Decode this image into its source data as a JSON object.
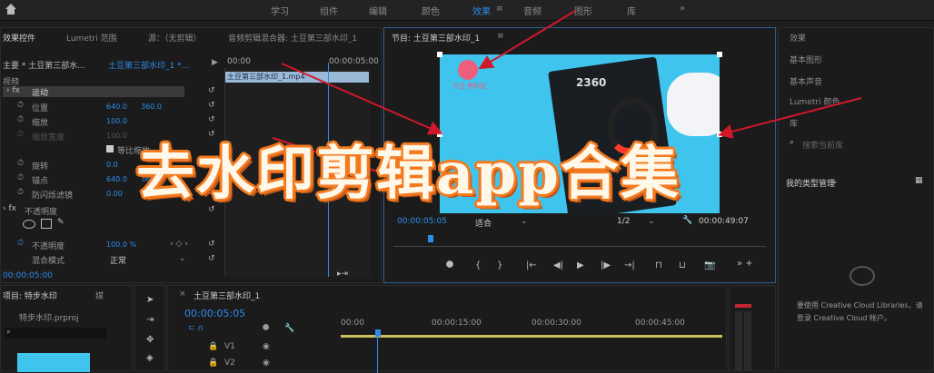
{
  "topbar": {
    "home_icon": "home-icon",
    "tabs": [
      "学习",
      "组件",
      "编辑",
      "颜色",
      "效果",
      "音频",
      "图形",
      "库"
    ],
    "active_index": 4,
    "more": "»"
  },
  "effects_panel": {
    "tabs": [
      "效果控件",
      "Lumetri 范围",
      "源：（无剪辑）",
      "音频剪辑混合器: 土豆第三部水印_1"
    ],
    "source_label": "主要 * 土豆第三部水...",
    "sequence_label": "土豆第三部水印_1 *...",
    "timecode_start": "00:00",
    "timecode_mark": "00:00:05:00",
    "clip_name": "土豆第三部水印_1.mp4",
    "video_section": "视频",
    "motion": "运动",
    "properties": [
      {
        "label": "位置",
        "v1": "640.0",
        "v2": "360.0"
      },
      {
        "label": "缩放",
        "v1": "100.0",
        "v2": ""
      },
      {
        "label": "缩放宽度",
        "v1": "100.0",
        "v2": ""
      },
      {
        "label": "等比缩放",
        "v1": "",
        "v2": ""
      },
      {
        "label": "旋转",
        "v1": "0.0",
        "v2": ""
      },
      {
        "label": "锚点",
        "v1": "640.0",
        "v2": "360.0"
      },
      {
        "label": "防闪烁滤镜",
        "v1": "0.00",
        "v2": ""
      }
    ],
    "opacity_section": "不透明度",
    "opacity_label": "不透明度",
    "opacity_value": "100.0 %",
    "blend_label": "混合模式",
    "blend_value": "正常",
    "bottom_timecode": "00:00:05:00"
  },
  "program": {
    "title": "节目: 土豆第三部水印_1",
    "menu_icon": "≡",
    "video_logo_text": "今日·黑科技",
    "brand_text": "2360",
    "current_time": "00:00:05:05",
    "fit": "适合",
    "resolution": "1/2",
    "duration": "00:00:49:07"
  },
  "right_panel": {
    "title": "效果",
    "items": [
      "基本图形",
      "基本声音",
      "Lumetri 颜色",
      "库"
    ],
    "search_placeholder": "搜索当前库",
    "library_view": "我的类型管理",
    "cc_text_1": "要使用 Creative Cloud Libraries，请",
    "cc_text_2": "登录 Creative Cloud 帐户。"
  },
  "project_panel": {
    "tabs": [
      "项目: 特步水印",
      "媒"
    ],
    "file": "特步水印.prproj"
  },
  "timeline": {
    "title": "土豆第三部水印_1",
    "timecode": "00:00:05:05",
    "ruler": [
      "00:00",
      "00:00:15:00",
      "00:00:30:00",
      "00:00:45:00"
    ],
    "tracks": [
      "V1",
      "V2"
    ]
  },
  "overlay": {
    "banner_text": "去水印剪辑app合集"
  },
  "colors": {
    "accent": "#2d8ceb",
    "video_bg": "#3fc4ee",
    "arrow": "#d0182b",
    "banner_stroke": "#f47a1f"
  }
}
